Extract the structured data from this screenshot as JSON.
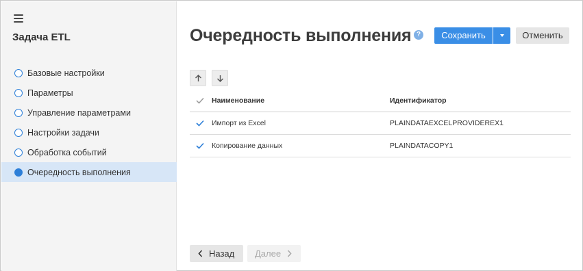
{
  "sidebar": {
    "title": "Задача ETL",
    "items": [
      {
        "label": "Базовые настройки",
        "active": false
      },
      {
        "label": "Параметры",
        "active": false
      },
      {
        "label": "Управление параметрами",
        "active": false
      },
      {
        "label": "Настройки задачи",
        "active": false
      },
      {
        "label": "Обработка событий",
        "active": false
      },
      {
        "label": "Очередность выполнения",
        "active": true
      }
    ]
  },
  "header": {
    "title": "Очередность выполнения",
    "help_glyph": "?",
    "save_label": "Сохранить",
    "cancel_label": "Отменить"
  },
  "table": {
    "columns": [
      "Наименование",
      "Идентификатор"
    ],
    "rows": [
      {
        "checked": true,
        "name": "Импорт из Excel",
        "id": "PLAINDATAEXCELPROVIDEREX1"
      },
      {
        "checked": true,
        "name": "Копирование данных",
        "id": "PLAINDATACOPY1"
      }
    ]
  },
  "footer": {
    "back_label": "Назад",
    "next_label": "Далее"
  },
  "colors": {
    "accent": "#3a8ee6",
    "active_bg": "#d7e6f7",
    "sidebar_bg": "#f4f4f4"
  }
}
